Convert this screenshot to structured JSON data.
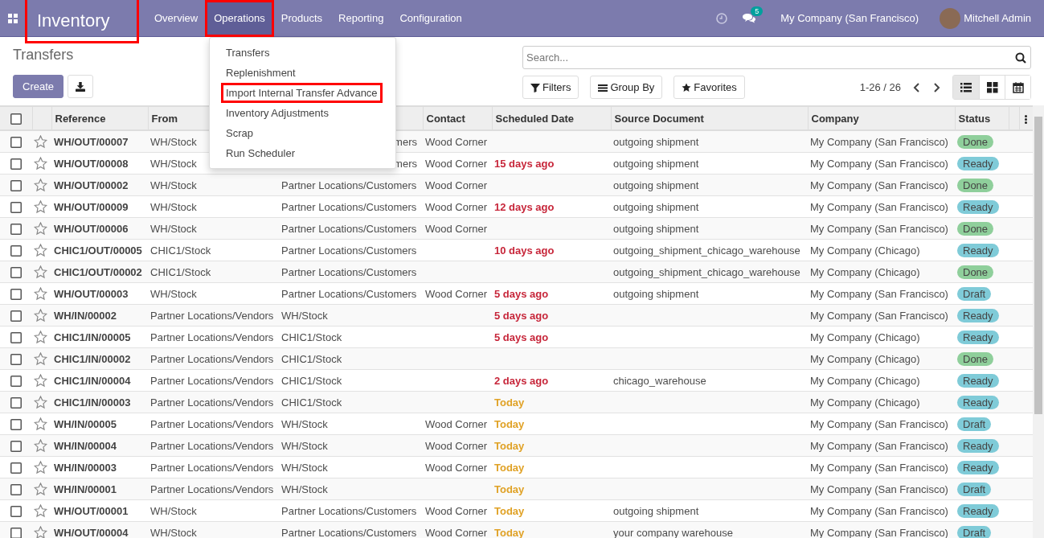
{
  "navbar": {
    "app_name": "Inventory",
    "app_highlighted": true,
    "menu": [
      {
        "label": "Overview",
        "selected": false,
        "highlighted": false
      },
      {
        "label": "Operations",
        "selected": true,
        "highlighted": true
      },
      {
        "label": "Products",
        "selected": false,
        "highlighted": false
      },
      {
        "label": "Reporting",
        "selected": false,
        "highlighted": false
      },
      {
        "label": "Configuration",
        "selected": false,
        "highlighted": false
      }
    ],
    "messages_badge": "5",
    "company": "My Company (San Francisco)",
    "user": "Mitchell Admin"
  },
  "dropdown": [
    {
      "label": "Transfers",
      "highlighted": false
    },
    {
      "label": "Replenishment",
      "highlighted": false
    },
    {
      "label": "Import Internal Transfer Advance",
      "highlighted": true
    },
    {
      "label": "Inventory Adjustments",
      "highlighted": false
    },
    {
      "label": "Scrap",
      "highlighted": false
    },
    {
      "label": "Run Scheduler",
      "highlighted": false
    }
  ],
  "control_panel": {
    "title": "Transfers",
    "create_label": "Create",
    "search_placeholder": "Search...",
    "filters": [
      "Filters",
      "Group By",
      "Favorites"
    ],
    "pager": "1-26 / 26",
    "views": [
      {
        "kind": "list",
        "selected": true
      },
      {
        "kind": "kanban",
        "selected": false
      },
      {
        "kind": "calendar",
        "selected": false
      }
    ]
  },
  "table": {
    "all_checked": false,
    "columns": [
      "Reference",
      "From",
      "",
      "Contact",
      "Scheduled Date",
      "Source Document",
      "Company",
      "Status"
    ],
    "rows": [
      {
        "checked": false,
        "starred": false,
        "reference": "WH/OUT/00007",
        "from": "WH/Stock",
        "to": "mers",
        "to_clipped": true,
        "contact": "Wood Corner",
        "source": "outgoing shipment",
        "company": "My Company (San Francisco)",
        "status": {
          "text": "Done",
          "kind": "done"
        }
      },
      {
        "checked": false,
        "starred": false,
        "reference": "WH/OUT/00008",
        "from": "WH/Stock",
        "to": "mers",
        "to_clipped": true,
        "contact": "Wood Corner",
        "date": {
          "text": "15 days ago",
          "kind": "late"
        },
        "source": "outgoing shipment",
        "company": "My Company (San Francisco)",
        "status": {
          "text": "Ready",
          "kind": "ready"
        }
      },
      {
        "checked": false,
        "starred": false,
        "reference": "WH/OUT/00002",
        "from": "WH/Stock",
        "to": "Partner Locations/Customers",
        "contact": "Wood Corner",
        "source": "outgoing shipment",
        "company": "My Company (San Francisco)",
        "status": {
          "text": "Done",
          "kind": "done"
        }
      },
      {
        "checked": false,
        "starred": false,
        "reference": "WH/OUT/00009",
        "from": "WH/Stock",
        "to": "Partner Locations/Customers",
        "contact": "Wood Corner",
        "date": {
          "text": "12 days ago",
          "kind": "late"
        },
        "source": "outgoing shipment",
        "company": "My Company (San Francisco)",
        "status": {
          "text": "Ready",
          "kind": "ready"
        }
      },
      {
        "checked": false,
        "starred": false,
        "reference": "WH/OUT/00006",
        "from": "WH/Stock",
        "to": "Partner Locations/Customers",
        "contact": "Wood Corner",
        "source": "outgoing shipment",
        "company": "My Company (San Francisco)",
        "status": {
          "text": "Done",
          "kind": "done"
        }
      },
      {
        "checked": false,
        "starred": false,
        "reference": "CHIC1/OUT/00005",
        "from": "CHIC1/Stock",
        "to": "Partner Locations/Customers",
        "date": {
          "text": "10 days ago",
          "kind": "late"
        },
        "source": "outgoing_shipment_chicago_warehouse",
        "company": "My Company (Chicago)",
        "status": {
          "text": "Ready",
          "kind": "ready"
        }
      },
      {
        "checked": false,
        "starred": false,
        "reference": "CHIC1/OUT/00002",
        "from": "CHIC1/Stock",
        "to": "Partner Locations/Customers",
        "source": "outgoing_shipment_chicago_warehouse",
        "company": "My Company (Chicago)",
        "status": {
          "text": "Done",
          "kind": "done"
        }
      },
      {
        "checked": false,
        "starred": false,
        "reference": "WH/OUT/00003",
        "from": "WH/Stock",
        "to": "Partner Locations/Customers",
        "contact": "Wood Corner",
        "date": {
          "text": "5 days ago",
          "kind": "late"
        },
        "source": "outgoing shipment",
        "company": "My Company (San Francisco)",
        "status": {
          "text": "Draft",
          "kind": "draft"
        }
      },
      {
        "checked": false,
        "starred": false,
        "reference": "WH/IN/00002",
        "from": "Partner Locations/Vendors",
        "to": "WH/Stock",
        "date": {
          "text": "5 days ago",
          "kind": "late"
        },
        "company": "My Company (San Francisco)",
        "status": {
          "text": "Ready",
          "kind": "ready"
        }
      },
      {
        "checked": false,
        "starred": false,
        "reference": "CHIC1/IN/00005",
        "from": "Partner Locations/Vendors",
        "to": "CHIC1/Stock",
        "date": {
          "text": "5 days ago",
          "kind": "late"
        },
        "company": "My Company (Chicago)",
        "status": {
          "text": "Ready",
          "kind": "ready"
        }
      },
      {
        "checked": false,
        "starred": false,
        "reference": "CHIC1/IN/00002",
        "from": "Partner Locations/Vendors",
        "to": "CHIC1/Stock",
        "company": "My Company (Chicago)",
        "status": {
          "text": "Done",
          "kind": "done"
        }
      },
      {
        "checked": false,
        "starred": false,
        "reference": "CHIC1/IN/00004",
        "from": "Partner Locations/Vendors",
        "to": "CHIC1/Stock",
        "date": {
          "text": "2 days ago",
          "kind": "late"
        },
        "source": "chicago_warehouse",
        "company": "My Company (Chicago)",
        "status": {
          "text": "Ready",
          "kind": "ready"
        }
      },
      {
        "checked": false,
        "starred": false,
        "reference": "CHIC1/IN/00003",
        "from": "Partner Locations/Vendors",
        "to": "CHIC1/Stock",
        "date": {
          "text": "Today",
          "kind": "today"
        },
        "company": "My Company (Chicago)",
        "status": {
          "text": "Ready",
          "kind": "ready"
        }
      },
      {
        "checked": false,
        "starred": false,
        "reference": "WH/IN/00005",
        "from": "Partner Locations/Vendors",
        "to": "WH/Stock",
        "contact": "Wood Corner",
        "date": {
          "text": "Today",
          "kind": "today"
        },
        "company": "My Company (San Francisco)",
        "status": {
          "text": "Draft",
          "kind": "draft"
        }
      },
      {
        "checked": false,
        "starred": false,
        "reference": "WH/IN/00004",
        "from": "Partner Locations/Vendors",
        "to": "WH/Stock",
        "contact": "Wood Corner",
        "date": {
          "text": "Today",
          "kind": "today"
        },
        "company": "My Company (San Francisco)",
        "status": {
          "text": "Ready",
          "kind": "ready"
        }
      },
      {
        "checked": false,
        "starred": false,
        "reference": "WH/IN/00003",
        "from": "Partner Locations/Vendors",
        "to": "WH/Stock",
        "contact": "Wood Corner",
        "date": {
          "text": "Today",
          "kind": "today"
        },
        "company": "My Company (San Francisco)",
        "status": {
          "text": "Ready",
          "kind": "ready"
        }
      },
      {
        "checked": false,
        "starred": false,
        "reference": "WH/IN/00001",
        "from": "Partner Locations/Vendors",
        "to": "WH/Stock",
        "date": {
          "text": "Today",
          "kind": "today"
        },
        "company": "My Company (San Francisco)",
        "status": {
          "text": "Draft",
          "kind": "draft"
        }
      },
      {
        "checked": false,
        "starred": false,
        "reference": "WH/OUT/00001",
        "from": "WH/Stock",
        "to": "Partner Locations/Customers",
        "contact": "Wood Corner",
        "date": {
          "text": "Today",
          "kind": "today"
        },
        "source": "outgoing shipment",
        "company": "My Company (San Francisco)",
        "status": {
          "text": "Ready",
          "kind": "ready"
        }
      },
      {
        "checked": false,
        "starred": false,
        "reference": "WH/OUT/00004",
        "from": "WH/Stock",
        "to": "Partner Locations/Customers",
        "contact": "Wood Corner",
        "date": {
          "text": "Today",
          "kind": "today"
        },
        "source": "your company warehouse",
        "company": "My Company (San Francisco)",
        "status": {
          "text": "Draft",
          "kind": "draft"
        }
      }
    ]
  }
}
